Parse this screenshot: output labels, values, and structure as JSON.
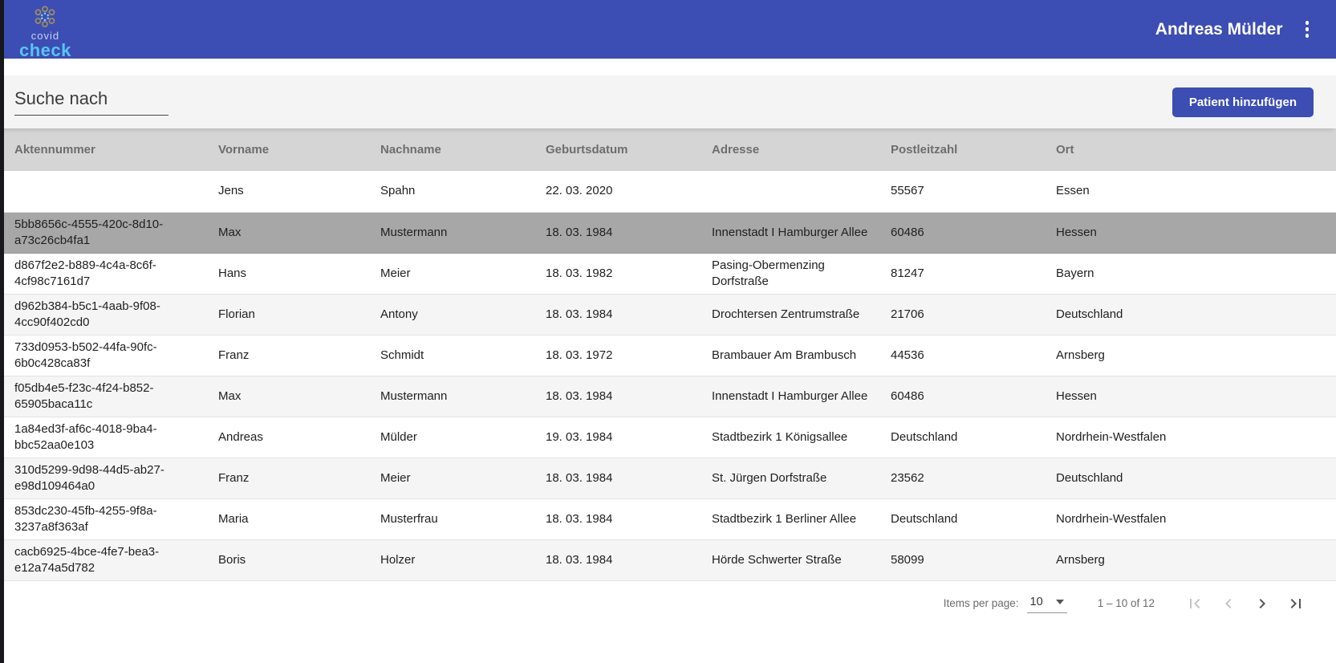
{
  "header": {
    "logo": {
      "line1": "covid",
      "line2": "check"
    },
    "user_name": "Andreas Mülder"
  },
  "toolbar": {
    "search_placeholder": "Suche nach",
    "add_button_label": "Patient hinzufügen"
  },
  "table": {
    "columns": [
      "Aktennummer",
      "Vorname",
      "Nachname",
      "Geburtsdatum",
      "Adresse",
      "Postleitzahl",
      "Ort"
    ],
    "rows": [
      {
        "aktennummer": "",
        "vorname": "Jens",
        "nachname": "Spahn",
        "geburtsdatum": "22. 03. 2020",
        "adresse": "",
        "postleitzahl": "55567",
        "ort": "Essen",
        "selected": false
      },
      {
        "aktennummer": "5bb8656c-4555-420c-8d10-a73c26cb4fa1",
        "vorname": "Max",
        "nachname": "Mustermann",
        "geburtsdatum": "18. 03. 1984",
        "adresse": "Innenstadt I Hamburger Allee",
        "postleitzahl": "60486",
        "ort": "Hessen",
        "selected": true
      },
      {
        "aktennummer": "d867f2e2-b889-4c4a-8c6f-4cf98c7161d7",
        "vorname": "Hans",
        "nachname": "Meier",
        "geburtsdatum": "18. 03. 1982",
        "adresse": "Pasing-Obermenzing Dorfstraße",
        "postleitzahl": "81247",
        "ort": "Bayern",
        "selected": false
      },
      {
        "aktennummer": "d962b384-b5c1-4aab-9f08-4cc90f402cd0",
        "vorname": "Florian",
        "nachname": "Antony",
        "geburtsdatum": "18. 03. 1984",
        "adresse": "Drochtersen Zentrumstraße",
        "postleitzahl": "21706",
        "ort": "Deutschland",
        "selected": false
      },
      {
        "aktennummer": "733d0953-b502-44fa-90fc-6b0c428ca83f",
        "vorname": "Franz",
        "nachname": "Schmidt",
        "geburtsdatum": "18. 03. 1972",
        "adresse": "Brambauer Am Brambusch",
        "postleitzahl": "44536",
        "ort": "Arnsberg",
        "selected": false
      },
      {
        "aktennummer": "f05db4e5-f23c-4f24-b852-65905baca11c",
        "vorname": "Max",
        "nachname": "Mustermann",
        "geburtsdatum": "18. 03. 1984",
        "adresse": "Innenstadt I Hamburger Allee",
        "postleitzahl": "60486",
        "ort": "Hessen",
        "selected": false
      },
      {
        "aktennummer": "1a84ed3f-af6c-4018-9ba4-bbc52aa0e103",
        "vorname": "Andreas",
        "nachname": "Mülder",
        "geburtsdatum": "19. 03. 1984",
        "adresse": "Stadtbezirk 1 Königsallee",
        "postleitzahl": "Deutschland",
        "ort": "Nordrhein-Westfalen",
        "selected": false
      },
      {
        "aktennummer": "310d5299-9d98-44d5-ab27-e98d109464a0",
        "vorname": "Franz",
        "nachname": "Meier",
        "geburtsdatum": "18. 03. 1984",
        "adresse": "St. Jürgen Dorfstraße",
        "postleitzahl": "23562",
        "ort": "Deutschland",
        "selected": false
      },
      {
        "aktennummer": "853dc230-45fb-4255-9f8a-3237a8f363af",
        "vorname": "Maria",
        "nachname": "Musterfrau",
        "geburtsdatum": "18. 03. 1984",
        "adresse": "Stadtbezirk 1 Berliner Allee",
        "postleitzahl": "Deutschland",
        "ort": "Nordrhein-Westfalen",
        "selected": false
      },
      {
        "aktennummer": "cacb6925-4bce-4fe7-bea3-e12a74a5d782",
        "vorname": "Boris",
        "nachname": "Holzer",
        "geburtsdatum": "18. 03. 1984",
        "adresse": "Hörde Schwerter Straße",
        "postleitzahl": "58099",
        "ort": "Arnsberg",
        "selected": false
      }
    ],
    "row_keys": [
      "aktennummer",
      "vorname",
      "nachname",
      "geburtsdatum",
      "adresse",
      "postleitzahl",
      "ort"
    ]
  },
  "paginator": {
    "items_per_page_label": "Items per page:",
    "items_per_page_value": "10",
    "range_label": "1 – 10 of 12",
    "icons": [
      "first-page-icon",
      "chevron-left-icon",
      "chevron-right-icon",
      "last-page-icon"
    ]
  },
  "colors": {
    "header_bg": "#3c4db4",
    "primary_button_bg": "#3c4db4",
    "logo_check_color": "#57c5f4",
    "logo_ring_color": "#9b8d5d",
    "table_header_bg": "#d5d5d5",
    "selected_row_bg": "#a7a7a7",
    "striped_row_bg": "#f5f5f6"
  }
}
